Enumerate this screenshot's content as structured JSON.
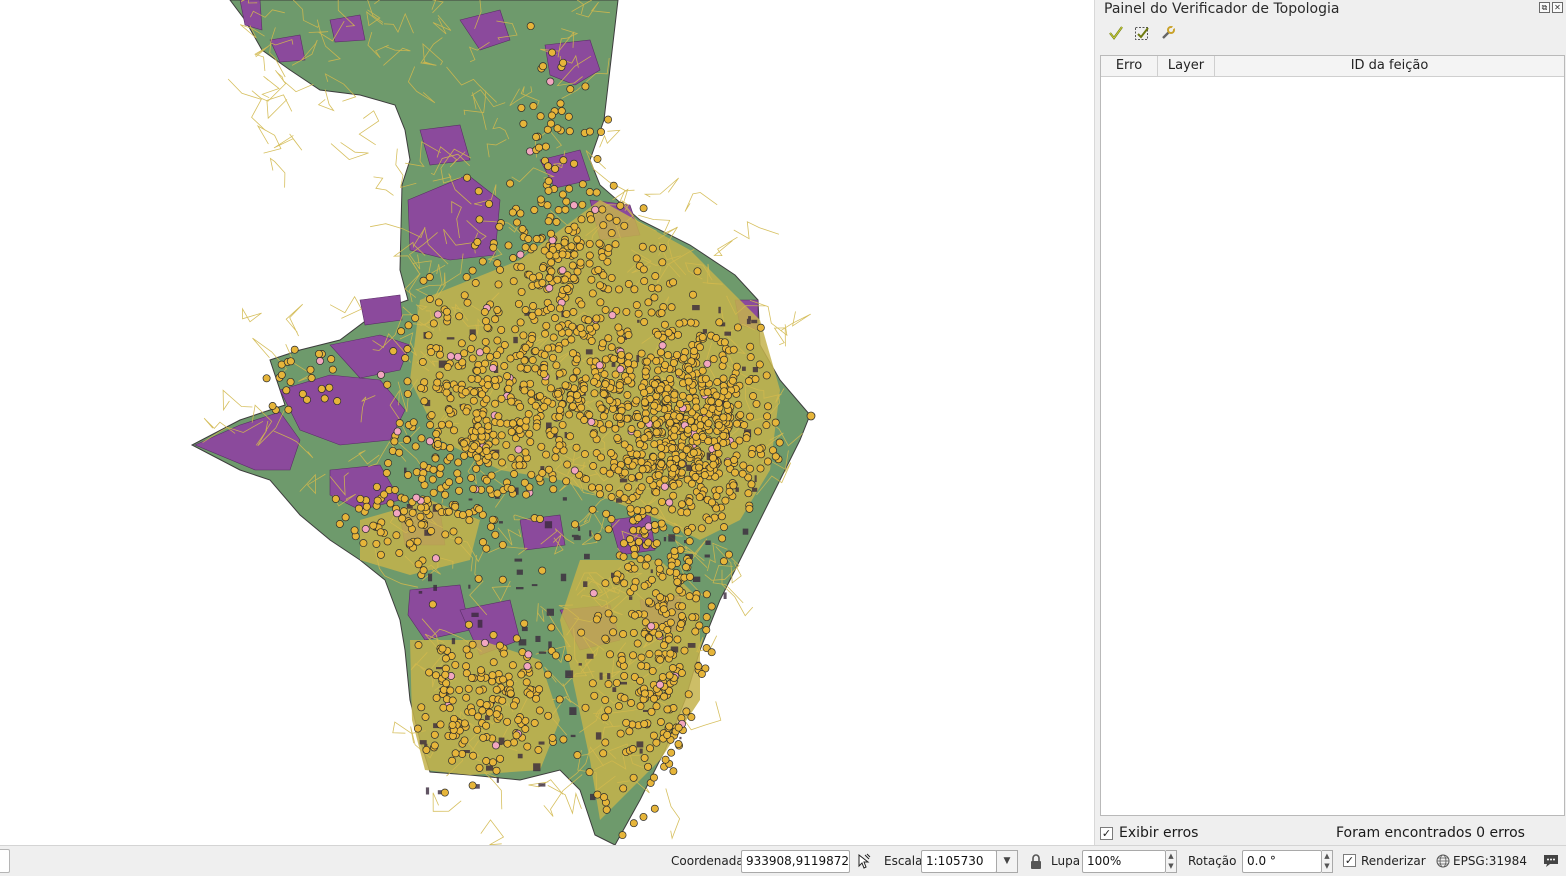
{
  "panel": {
    "title": "Painel do Verificador de Topologia",
    "toolbar_icons": [
      "validate-all-icon",
      "validate-extent-icon",
      "configure-rules-icon"
    ],
    "table": {
      "columns": [
        "Erro",
        "Layer",
        "ID da feição"
      ],
      "rows": []
    },
    "show_errors_label": "Exibir erros",
    "show_errors_checked": true,
    "errors_found": "Foram encontrados 0 erros"
  },
  "status_bar": {
    "coordinate_label": "Coordenada",
    "coordinate_value": "933908,9119872",
    "scale_label": "Escala",
    "scale_value": "1:105730",
    "magnifier_label": "Lupa",
    "magnifier_value": "100%",
    "rotation_label": "Rotação",
    "rotation_value": "0.0 °",
    "render_label": "Renderizar",
    "render_checked": true,
    "crs_value": "EPSG:31984"
  },
  "map": {
    "colors": {
      "green_area": "#6e9a6c",
      "purple_area": "#8b4a9c",
      "yellow_roads": "#c9b64a",
      "point_fill": "#e6b53a",
      "point_pink": "#f2a6c0",
      "dark_blocks": "#3a2a3d"
    }
  }
}
